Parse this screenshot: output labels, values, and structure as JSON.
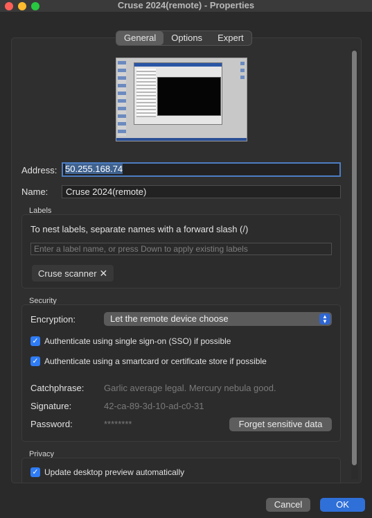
{
  "window": {
    "title": "Cruse 2024(remote) - Properties"
  },
  "tabs": [
    {
      "label": "General",
      "active": true
    },
    {
      "label": "Options",
      "active": false
    },
    {
      "label": "Expert",
      "active": false
    }
  ],
  "address": {
    "label": "Address:",
    "value": "50.255.168.74"
  },
  "name": {
    "label": "Name:",
    "value": "Cruse 2024(remote)"
  },
  "labels": {
    "title": "Labels",
    "hint": "To nest labels, separate names with a forward slash (/)",
    "placeholder": "Enter a label name, or press Down to apply existing labels",
    "chips": [
      {
        "label": "Cruse scanner",
        "remove": "✕"
      }
    ]
  },
  "security": {
    "title": "Security",
    "encryption_label": "Encryption:",
    "encryption_value": "Let the remote device choose",
    "sso_label": "Authenticate using single sign-on (SSO) if possible",
    "sso_checked": true,
    "smartcard_label": "Authenticate using a smartcard or certificate store if possible",
    "smartcard_checked": true,
    "catchphrase_label": "Catchphrase:",
    "catchphrase_value": "Garlic average legal. Mercury nebula good.",
    "signature_label": "Signature:",
    "signature_value": "42-ca-89-3d-10-ad-c0-31",
    "password_label": "Password:",
    "password_value": "********",
    "forget_button": "Forget sensitive data"
  },
  "privacy": {
    "title": "Privacy",
    "update_preview_label": "Update desktop preview automatically",
    "update_preview_checked": true
  },
  "footer": {
    "cancel": "Cancel",
    "ok": "OK"
  },
  "icons": {
    "close": "close-icon",
    "minimize": "minimize-icon",
    "maximize": "maximize-icon",
    "check": "checkmark-icon",
    "select_arrows": "chevron-updown-icon"
  },
  "colors": {
    "accent": "#2f6fd8",
    "checkbox": "#2f7cf6",
    "window_bg": "#2a2a2a"
  }
}
